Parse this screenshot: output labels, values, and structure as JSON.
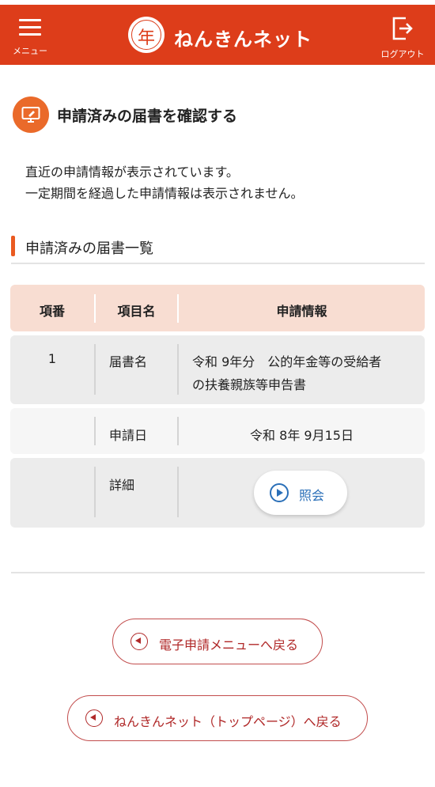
{
  "header": {
    "menu_label": "メニュー",
    "site_name": "ねんきんネット",
    "logo_mark": "年",
    "logout_label": "ログアウト",
    "brand_color": "#dd3d1a"
  },
  "page": {
    "title": "申請済みの届書を確認する",
    "title_icon": "computer-pen-icon",
    "description_lines": [
      "直近の申請情報が表示されています。",
      "一定期間を経過した申請情報は表示されません。"
    ]
  },
  "section": {
    "title": "申請済みの届書一覧"
  },
  "table": {
    "headers": [
      "項番",
      "項目名",
      "申請情報"
    ],
    "rows": [
      {
        "number": "1",
        "items": [
          {
            "name": "届書名",
            "value_lines": [
              "令和 9年分　公的年金等の受給者",
              "の扶養親族等申告書"
            ]
          },
          {
            "name": "申請日",
            "value": "令和 8年 9月15日"
          },
          {
            "name": "詳細",
            "button_label": "照会",
            "button_icon": "play-circle-icon"
          }
        ]
      }
    ]
  },
  "buttons": {
    "back_menu": "電子申請メニューへ戻る",
    "back_top": "ねんきんネット（トップページ）へ戻る"
  }
}
